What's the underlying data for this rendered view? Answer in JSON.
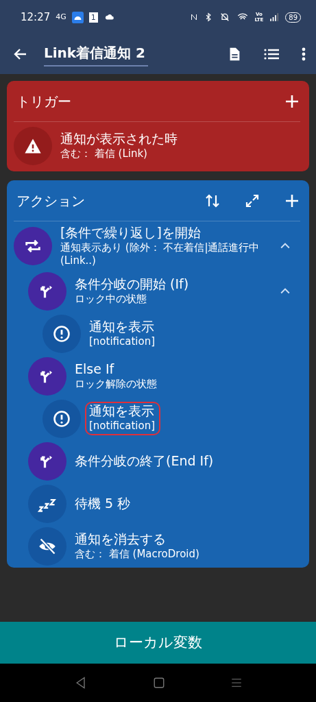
{
  "status_bar": {
    "time": "12:27",
    "network": "4G",
    "sim_badge": "1",
    "volte": [
      "Vo",
      "LTE"
    ],
    "battery": "89"
  },
  "app_bar": {
    "title": "Link着信通知 2"
  },
  "trigger_section": {
    "title": "トリガー",
    "items": [
      {
        "kind": "warning",
        "title": "通知が表示された時",
        "subtitle": "含む： 着信 (Link)"
      }
    ]
  },
  "action_section": {
    "title": "アクション",
    "items": [
      {
        "kind": "loop",
        "title": "[条件で繰り返し]を開始",
        "subtitle": "通知表示あり (除外： 不在着信|通話進行中 (Link..)",
        "expanded": true,
        "highlighted": false,
        "children": [
          {
            "kind": "branch",
            "title": "条件分岐の開始 (If)",
            "subtitle": "ロック中の状態",
            "expanded": true,
            "highlighted": false,
            "children": [
              {
                "kind": "alert",
                "title": "通知を表示",
                "subtitle": "[notification]",
                "highlighted": false
              }
            ]
          },
          {
            "kind": "branch",
            "title": "Else If",
            "subtitle": "ロック解除の状態",
            "highlighted": false,
            "children": [
              {
                "kind": "alert",
                "title": "通知を表示",
                "subtitle": "[notification]",
                "highlighted": true
              }
            ]
          },
          {
            "kind": "branch",
            "title": "条件分岐の終了(End If)",
            "highlighted": false
          },
          {
            "kind": "sleep",
            "title": "待機 5 秒",
            "highlighted": false
          },
          {
            "kind": "hide",
            "title": "通知を消去する",
            "subtitle": "含む： 着信 (MacroDroid)",
            "highlighted": false
          }
        ]
      }
    ]
  },
  "bottom_button": {
    "label": "ローカル変数"
  }
}
